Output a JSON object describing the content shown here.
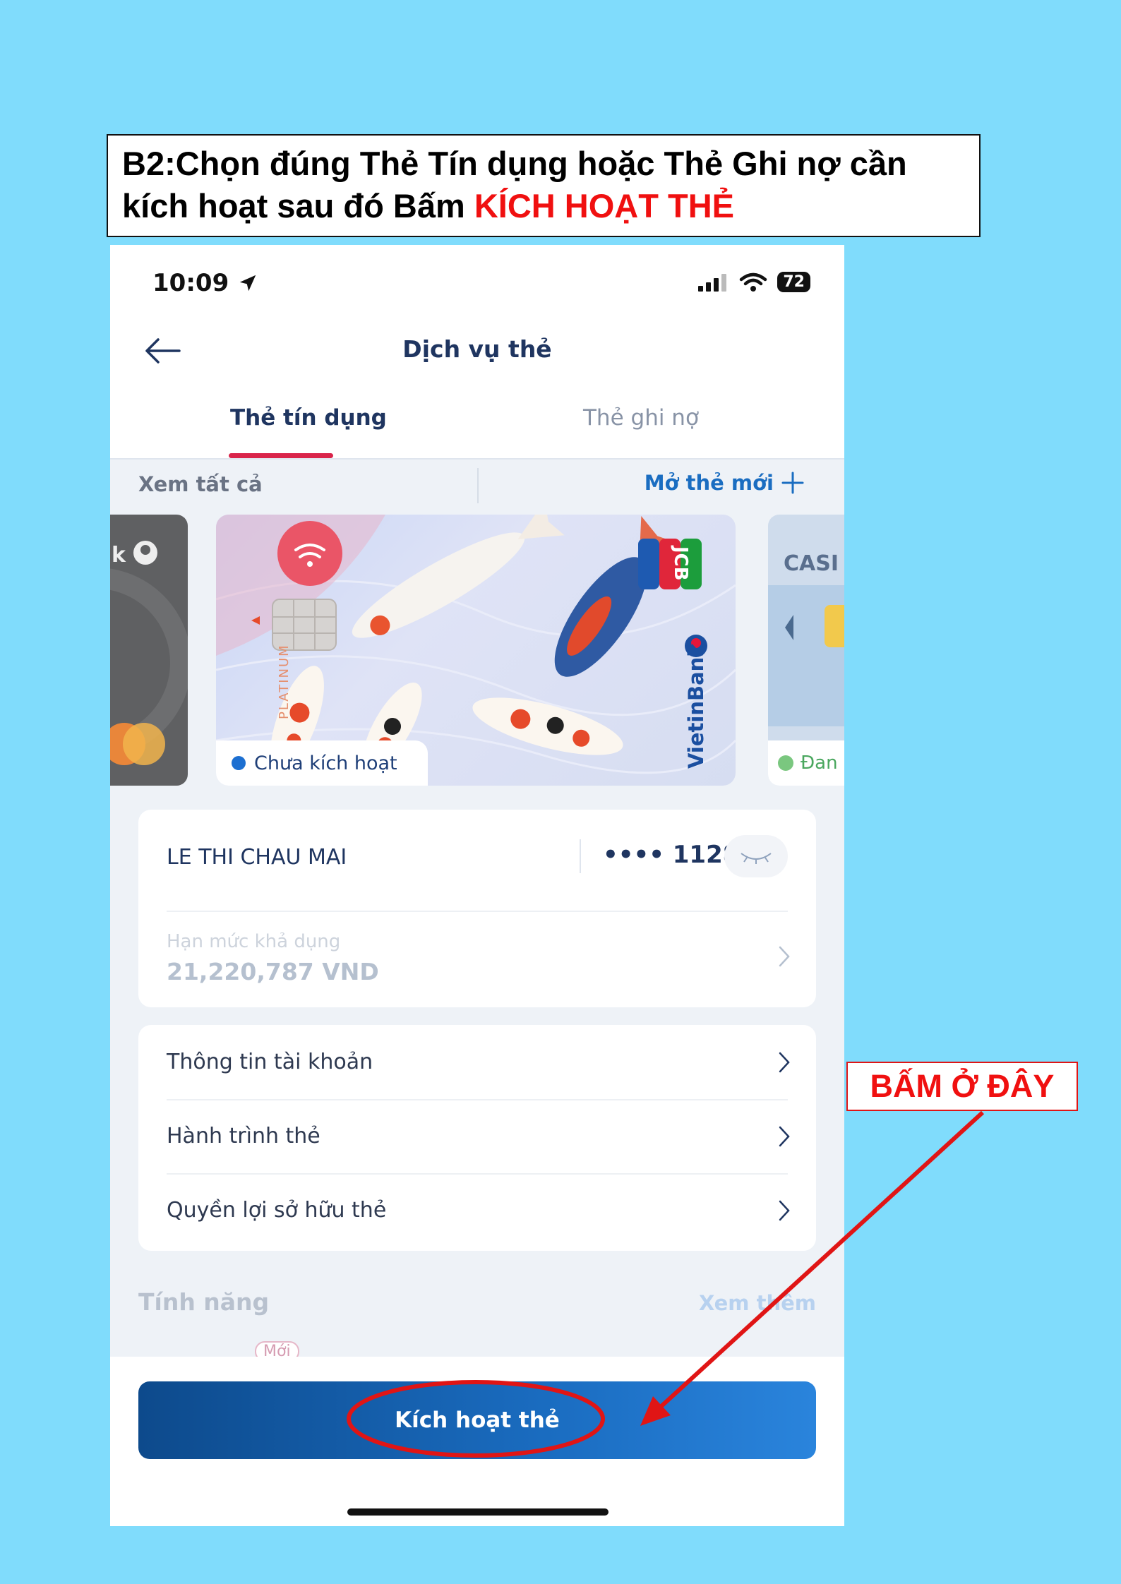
{
  "instruction": {
    "line1": "B2:Chọn đúng  Thẻ Tín dụng hoặc Thẻ Ghi nợ cần",
    "line2_prefix": "kích hoạt sau đó Bấm ",
    "line2_highlight": "KÍCH HOẠT THẺ"
  },
  "status_bar": {
    "time": "10:09",
    "battery": "72"
  },
  "header": {
    "title": "Dịch vụ thẻ"
  },
  "tabs": [
    {
      "label": "Thẻ tín dụng",
      "active": true
    },
    {
      "label": "Thẻ ghi nợ",
      "active": false
    }
  ],
  "cards_toolbar": {
    "see_all": "Xem tất cả",
    "open_new": "Mở thẻ mới"
  },
  "card": {
    "status": "Chưa kích hoạt",
    "brand": "VietinBank",
    "network": "JCB",
    "tier": "PLATINUM",
    "holder": "LE THI CHAU MAI",
    "masked_number": "•••• 1128",
    "limit_label": "Hạn mức khả dụng",
    "limit_value": "21,220,787 VND"
  },
  "side_cards": {
    "left_text": "k",
    "right_text": "CASI",
    "right_status": "Đan"
  },
  "menu": [
    {
      "label": "Thông tin tài khoản"
    },
    {
      "label": "Hành trình thẻ"
    },
    {
      "label": "Quyền lợi sở hữu thẻ"
    }
  ],
  "features": {
    "title": "Tính năng",
    "see_more": "Xem thêm",
    "new_badge": "Mới"
  },
  "activate_button": "Kích hoạt thẻ",
  "callout": "BẤM Ở ĐÂY",
  "colors": {
    "background": "#80dcfc",
    "annotation": "#f01010",
    "primary": "#1a6cc0",
    "tab_indicator": "#d9244a"
  }
}
